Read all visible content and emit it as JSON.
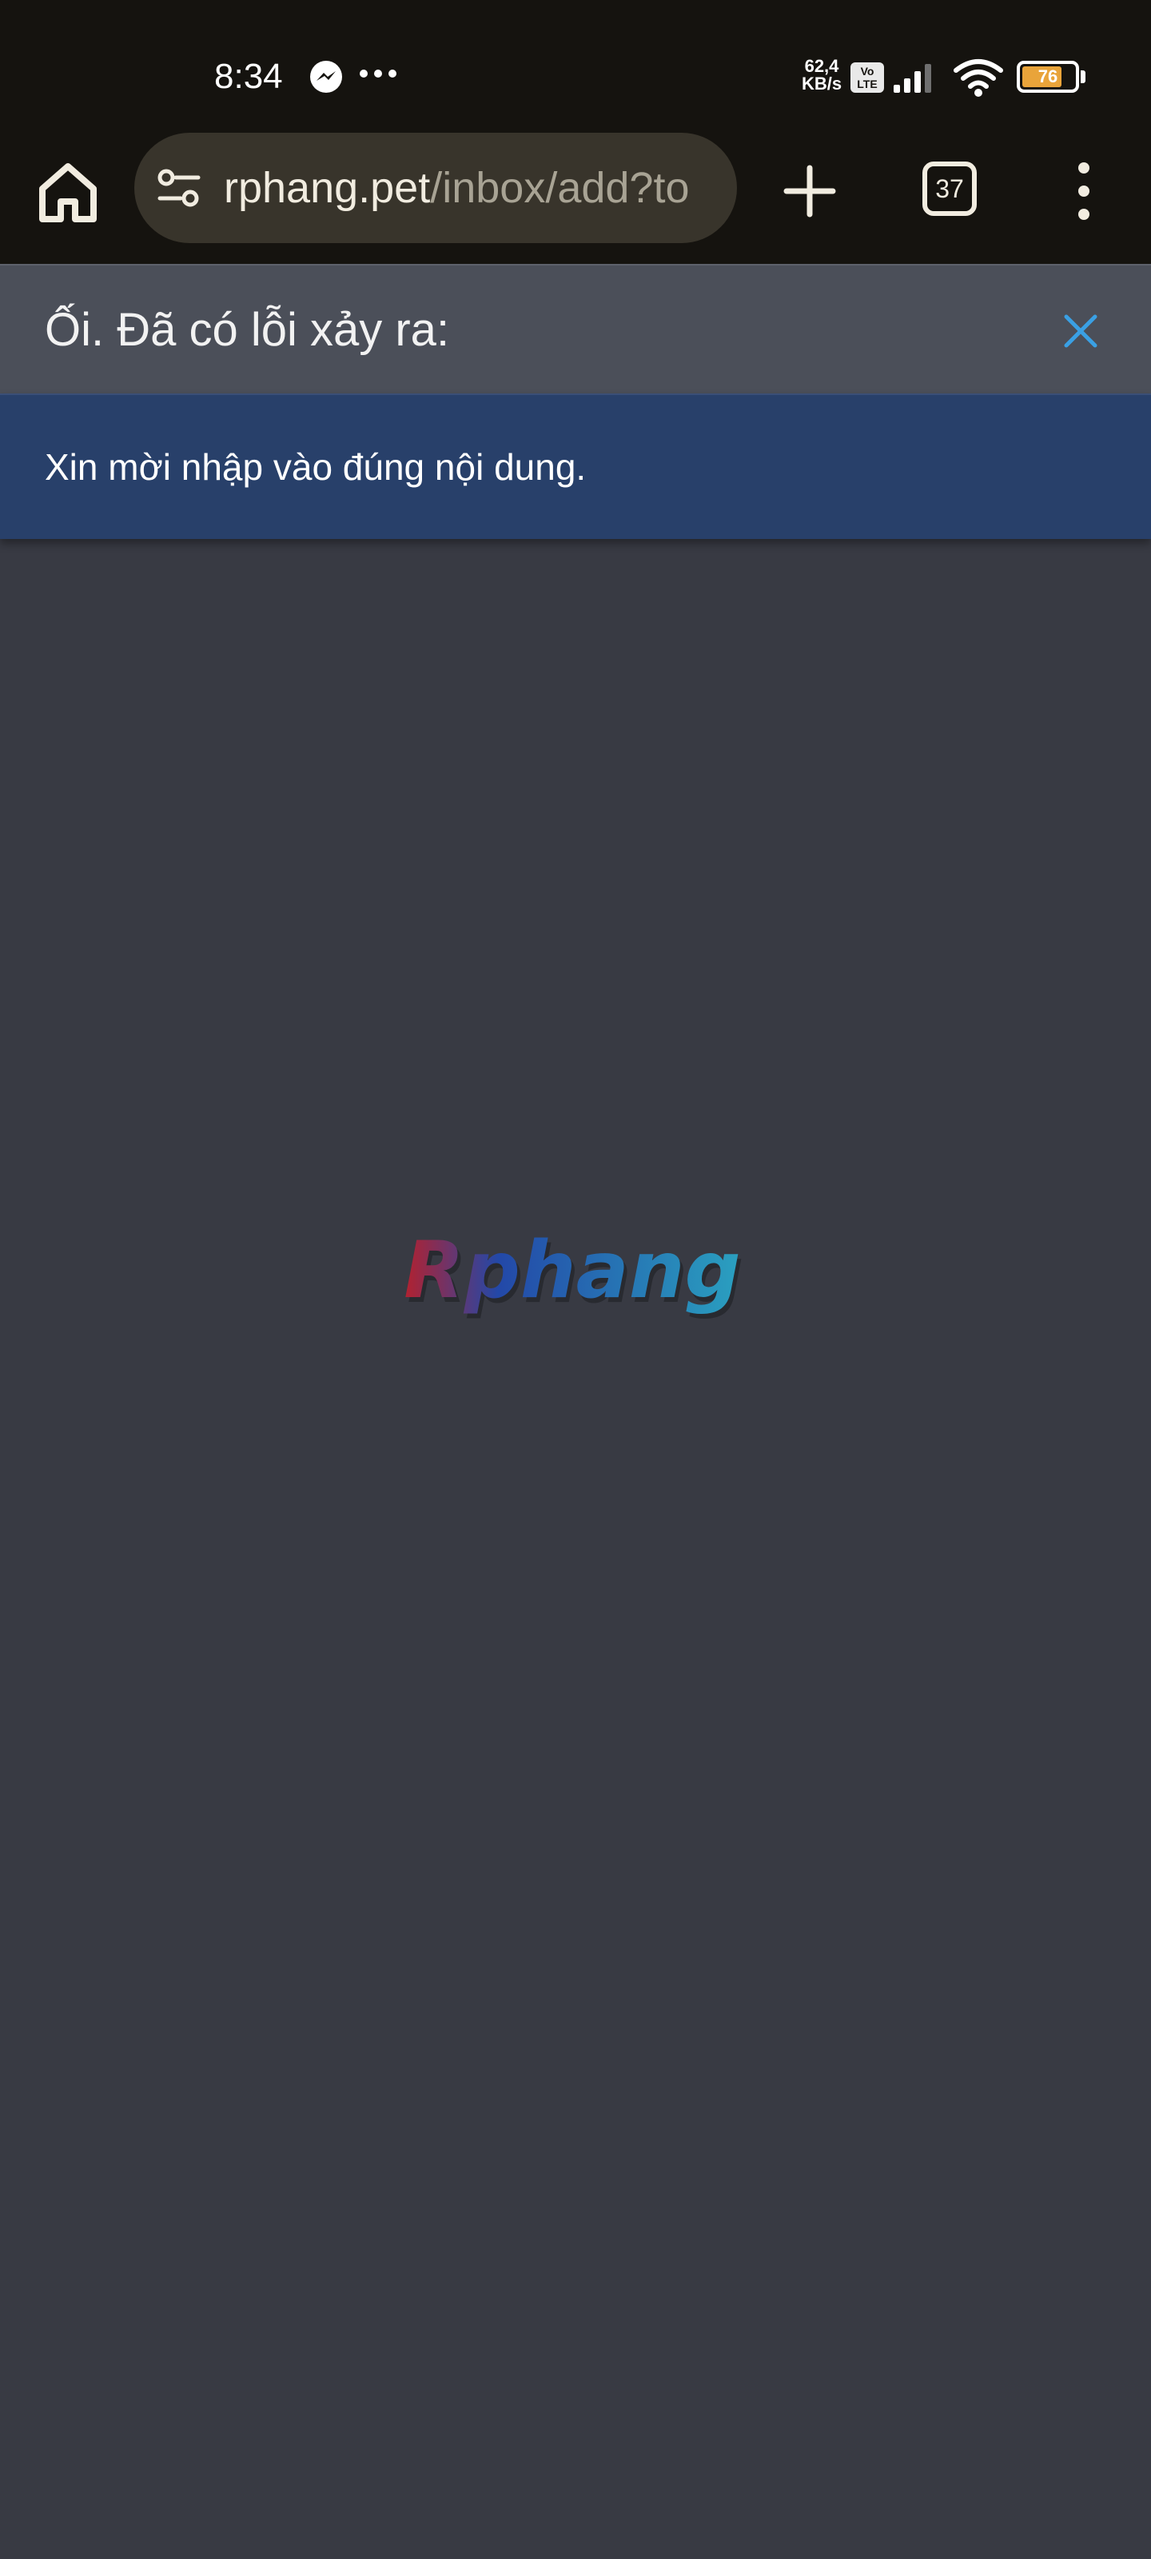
{
  "status_bar": {
    "time": "8:34",
    "net_speed_value": "62,4",
    "net_speed_unit": "KB/s",
    "volte_line1": "Vo",
    "volte_line2": "LTE",
    "battery_level": "76",
    "battery_fraction": 0.76,
    "icons": [
      "messenger-icon",
      "more-dots-icon",
      "signal-icon",
      "wifi-icon",
      "battery-icon"
    ]
  },
  "browser": {
    "url_domain": "rphang.pet",
    "url_path": "/inbox/add?to",
    "tab_count": "37",
    "icons": [
      "home-icon",
      "site-settings-icon",
      "plus-icon",
      "more-vert-icon"
    ]
  },
  "error": {
    "title": "Ối. Đã có lỗi xảy ra:",
    "message": "Xin mời nhập vào đúng nội dung.",
    "close_icon": "close-icon"
  },
  "logo": {
    "text": "Rphang",
    "colors": {
      "start": "#b3212f",
      "mid": "#2348a8",
      "end": "#2aa0c0"
    }
  },
  "colors": {
    "system_bar_bg": "#15130f",
    "url_bar_bg": "#38342b",
    "page_bg": "#383a43",
    "error_header_bg": "#4b4f59",
    "error_body_bg": "#28406a",
    "close_icon_color": "#3aa0e4"
  }
}
